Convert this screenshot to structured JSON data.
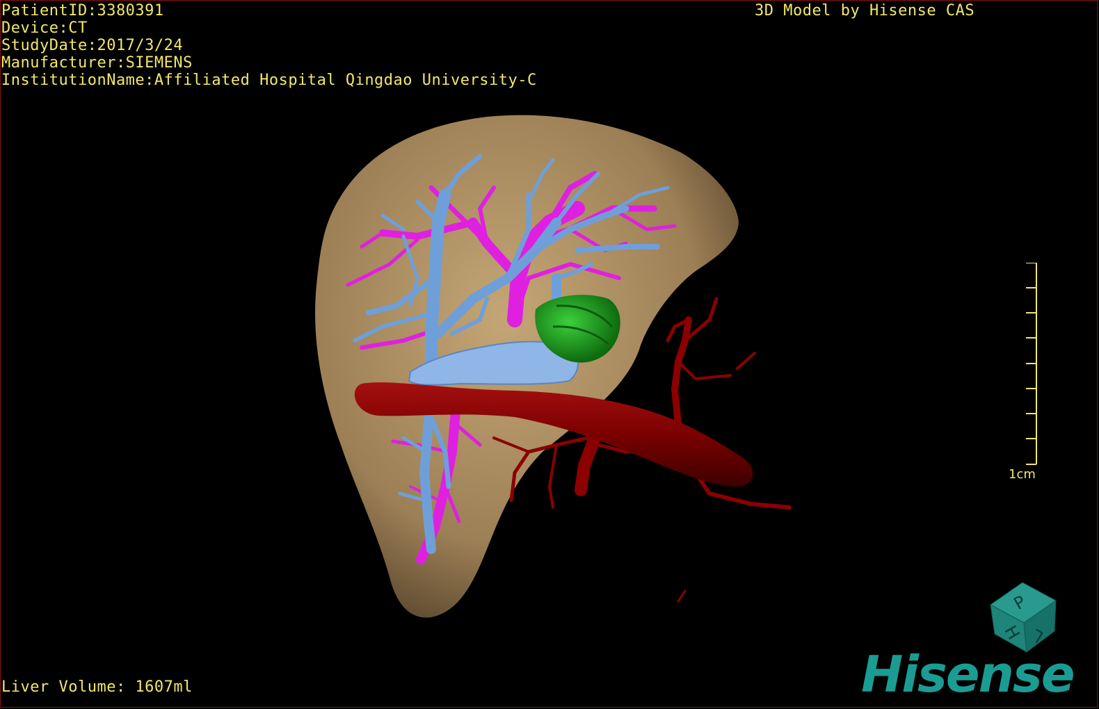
{
  "header": {
    "patient_id": "PatientID:3380391",
    "device": "Device:CT",
    "study_date": "StudyDate:2017/3/24",
    "manufacturer": "Manufacturer:SIEMENS",
    "institution": "InstitutionName:Affiliated Hospital Qingdao University-C"
  },
  "credit": "3D Model by Hisense CAS",
  "footer": {
    "liver_volume": "Liver Volume: 1607ml"
  },
  "scale": {
    "label": "1cm"
  },
  "orientation_cube": {
    "face_top": "P",
    "face_left": "H",
    "face_right": "L"
  },
  "brand": "Hisense",
  "colors": {
    "text": "#f2e86a",
    "liver": "#b89a6c",
    "portal_vein": "#6f9fd8",
    "hepatic_vein": "#e020e0",
    "artery": "#8b0000",
    "lesion": "#22a822",
    "brand": "#1a9c93"
  }
}
